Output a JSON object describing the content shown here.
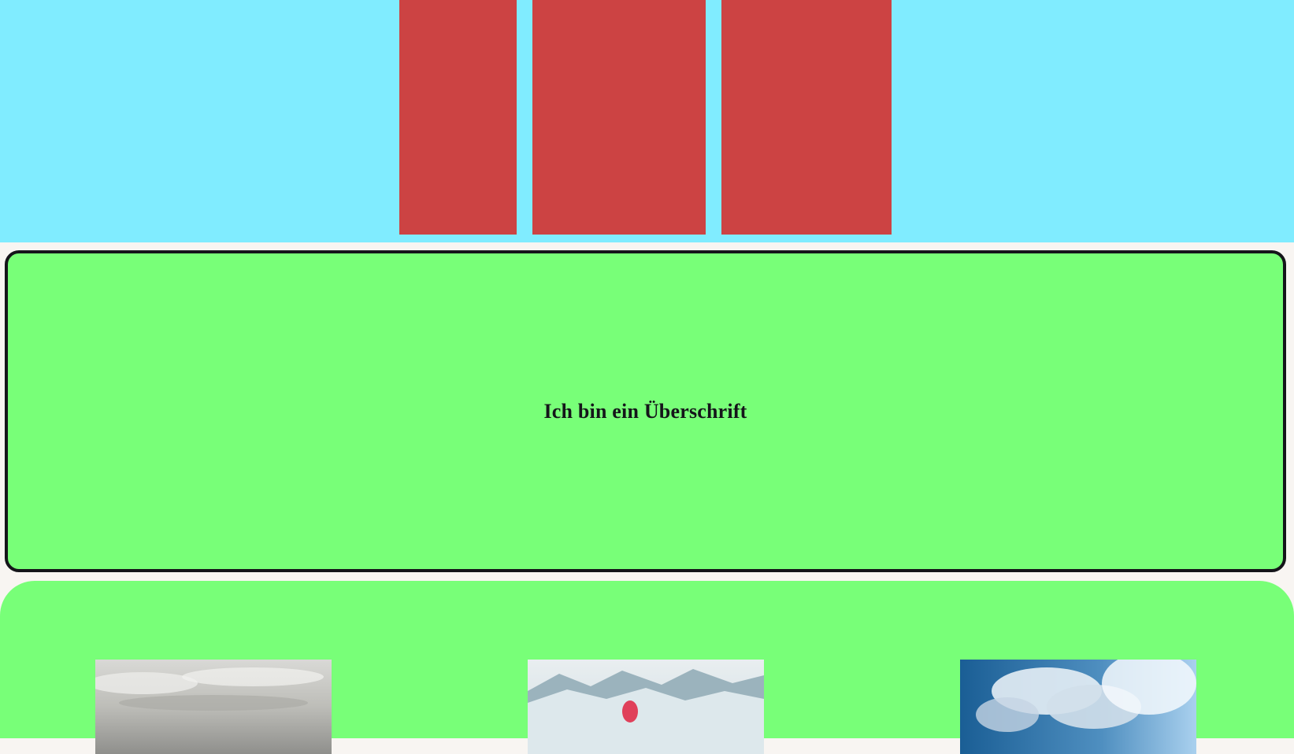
{
  "header": {
    "boxes": [
      {
        "name": "red-block-1",
        "color": "#cc4343"
      },
      {
        "name": "red-block-2",
        "color": "#cc4343"
      },
      {
        "name": "red-block-3",
        "color": "#cc4343"
      }
    ],
    "background": "#80ecff"
  },
  "hero": {
    "title": "Ich bin ein Überschrift",
    "background": "#78ff78",
    "border_color": "#15151a"
  },
  "gallery": {
    "background": "#78ff78",
    "images": [
      {
        "icon": "cloudy-sky-image"
      },
      {
        "icon": "snowy-mountain-balloon-image"
      },
      {
        "icon": "blue-sky-clouds-image"
      }
    ]
  }
}
